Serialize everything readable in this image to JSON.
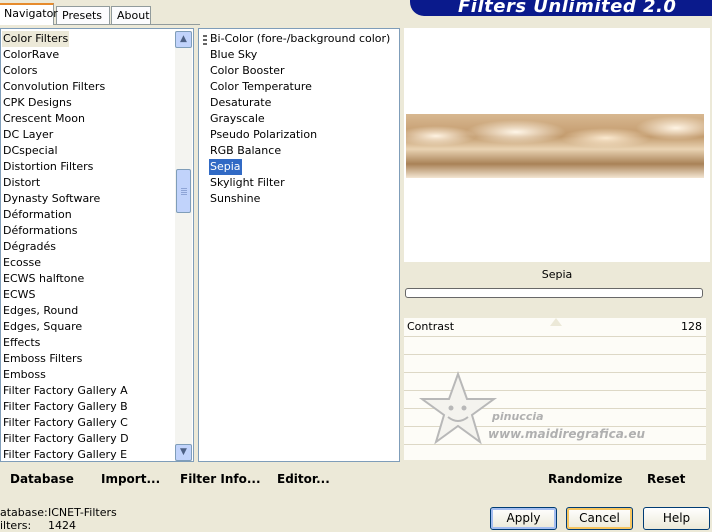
{
  "tabs": [
    "Navigator",
    "Presets",
    "About"
  ],
  "banner": "Filters Unlimited 2.0",
  "categories": [
    "Color Filters",
    "ColorRave",
    "Colors",
    "Convolution Filters",
    "CPK Designs",
    "Crescent Moon",
    "DC Layer",
    "DCspecial",
    "Distortion Filters",
    "Distort",
    "Dynasty Software",
    "Déformation",
    "Déformations",
    "Dégradés",
    "Ecosse",
    "ECWS halftone",
    "ECWS",
    "Edges, Round",
    "Edges, Square",
    "Effects",
    "Emboss Filters",
    "Emboss",
    "Filter Factory Gallery A",
    "Filter Factory Gallery B",
    "Filter Factory Gallery C",
    "Filter Factory Gallery D",
    "Filter Factory Gallery E"
  ],
  "filters": [
    "Bi-Color (fore-/background color)",
    "Blue Sky",
    "Color Booster",
    "Color Temperature",
    "Desaturate",
    "Grayscale",
    "Pseudo Polarization",
    "RGB Balance",
    "Sepia",
    "Skylight Filter",
    "Sunshine"
  ],
  "selected_category": "Color Filters",
  "selected_filter": "Sepia",
  "preview": {
    "filter_name": "Sepia"
  },
  "controls": {
    "label": "Contrast",
    "value": "128"
  },
  "watermark": {
    "line1": "pinuccia",
    "line2": "www.maidiregrafica.eu"
  },
  "toolbar": {
    "database": "Database",
    "import": "Import...",
    "filter_info": "Filter Info...",
    "editor": "Editor...",
    "randomize": "Randomize",
    "reset": "Reset"
  },
  "status": {
    "db_label": "atabase:",
    "db_value": "ICNET-Filters",
    "filters_label": "ilters:",
    "filters_value": "1424"
  },
  "buttons": {
    "apply": "Apply",
    "cancel": "Cancel",
    "help": "Help"
  }
}
